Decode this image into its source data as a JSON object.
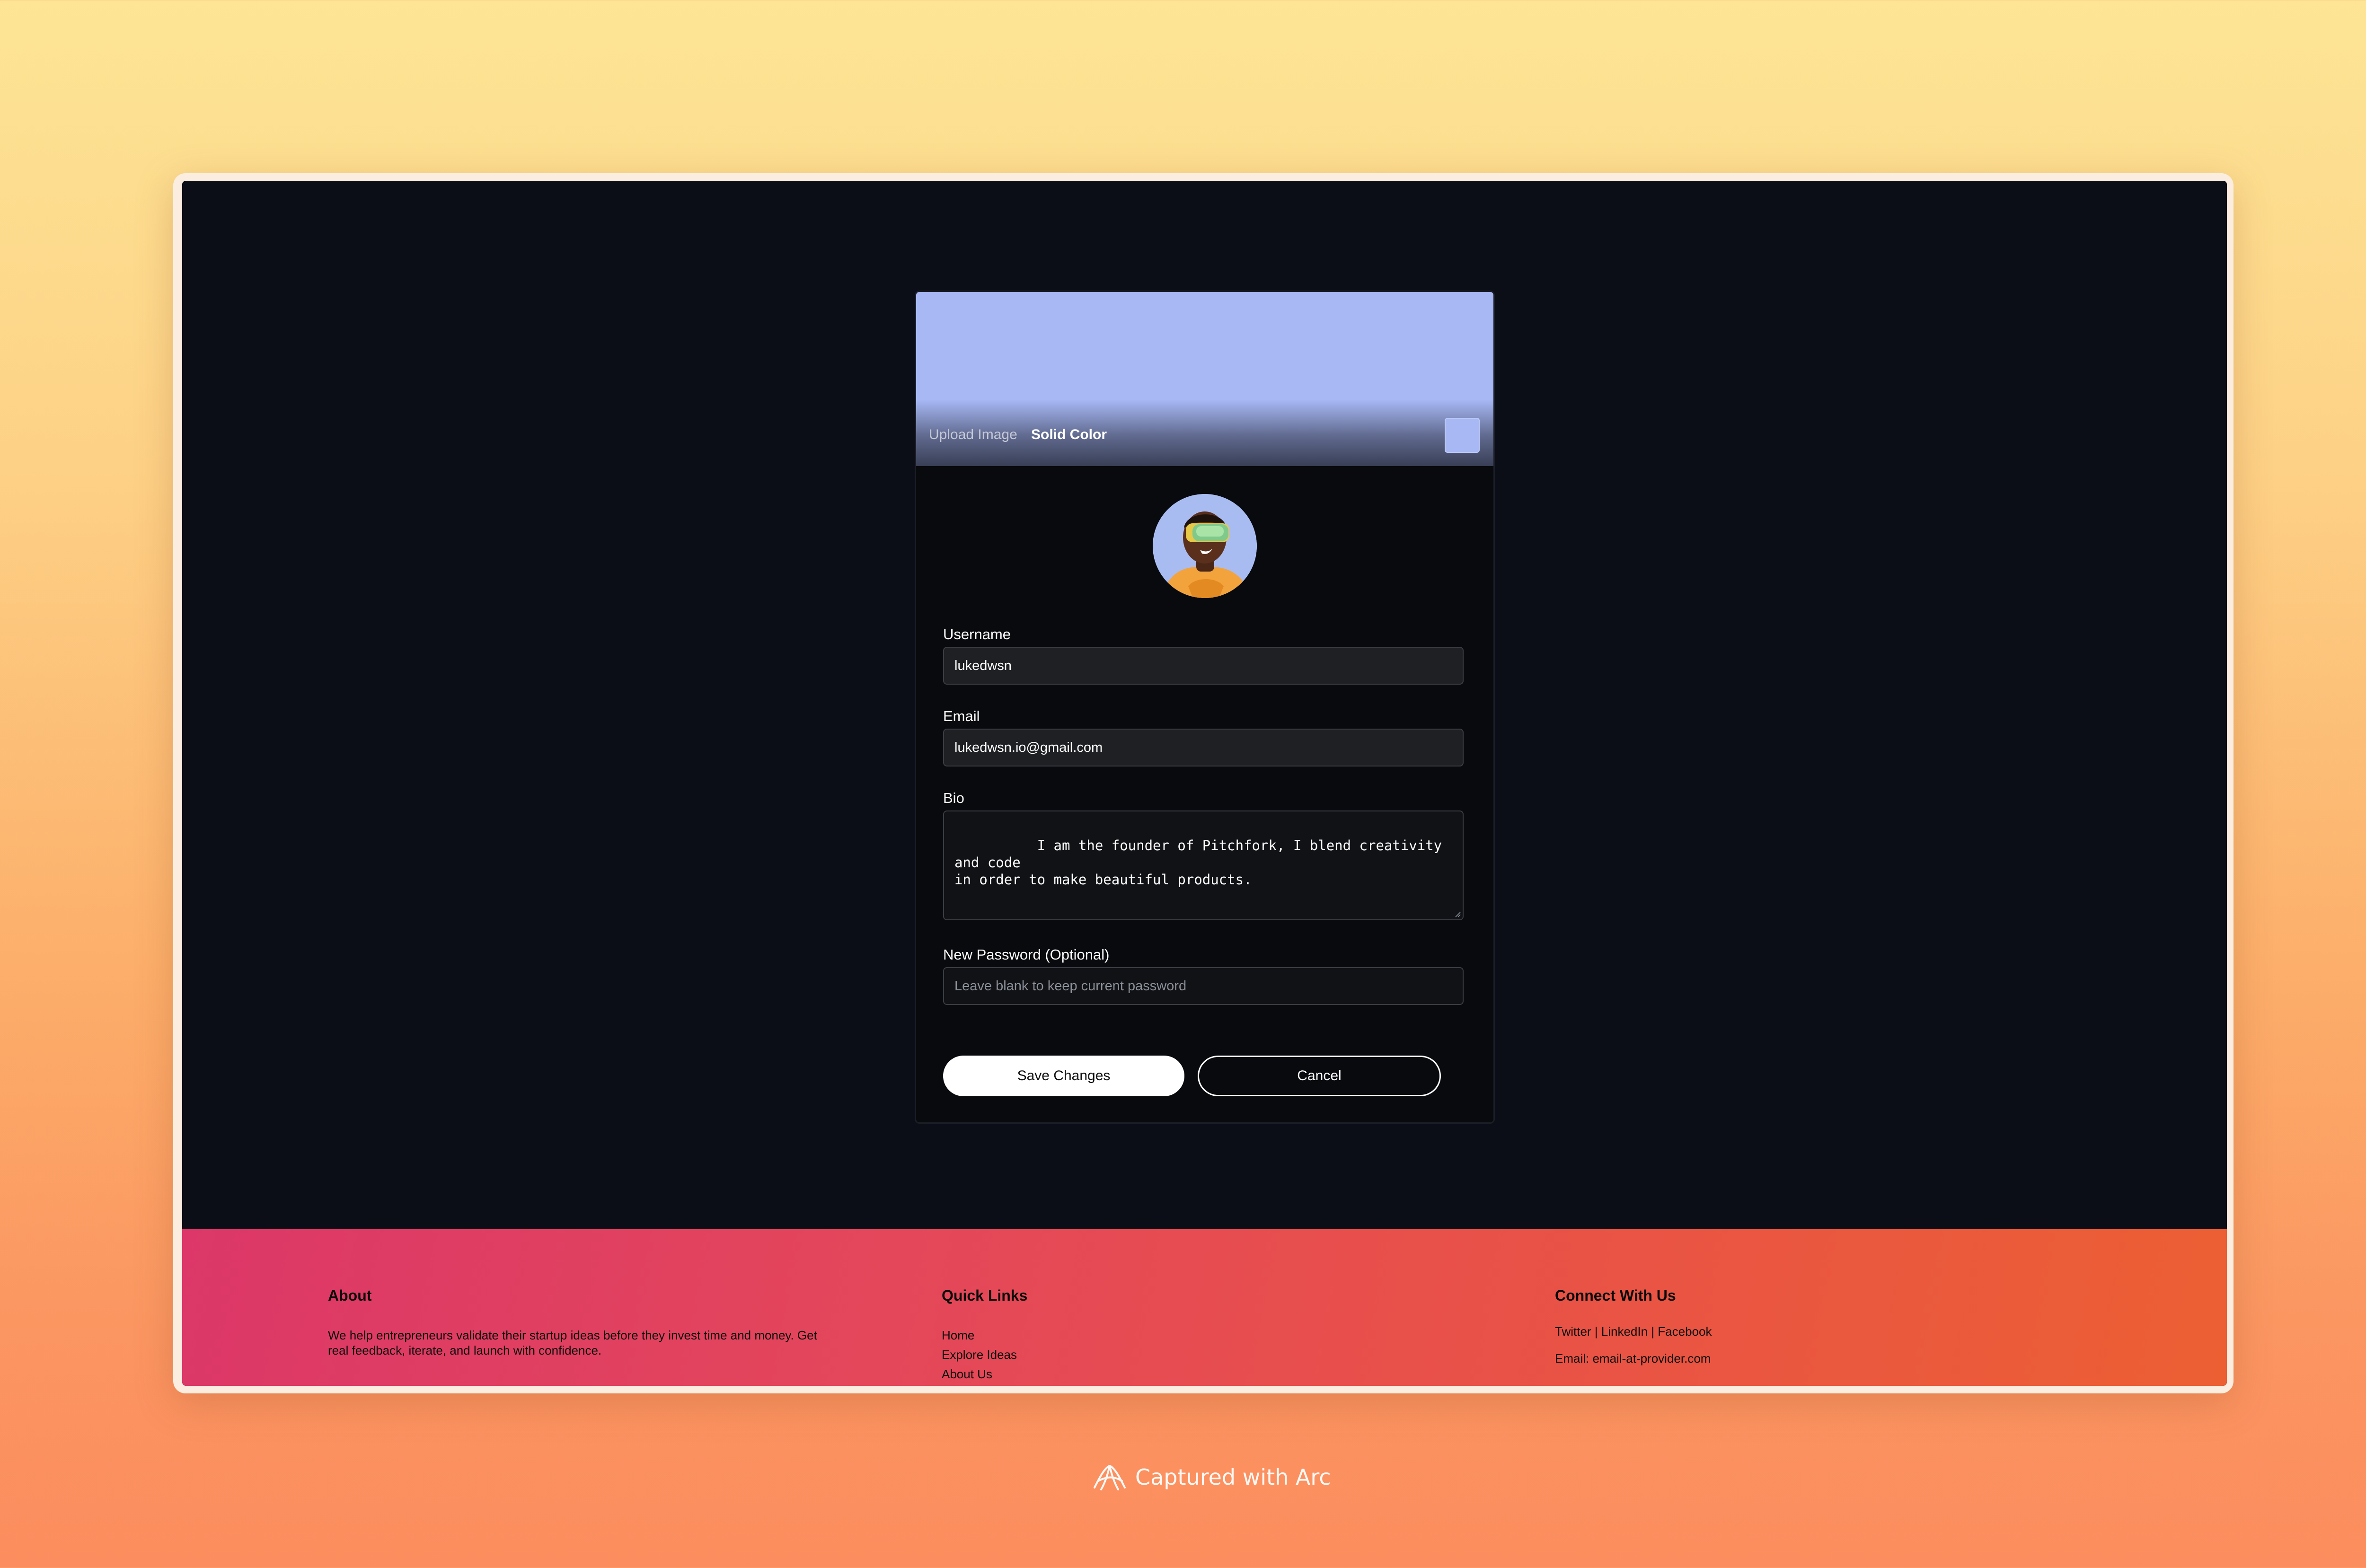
{
  "banner": {
    "tabs": [
      "Upload Image",
      "Solid Color"
    ],
    "active_tab": "Solid Color",
    "color": "#a7b8f5"
  },
  "avatar": {
    "icon": "vr-headset-avatar"
  },
  "form": {
    "username": {
      "label": "Username",
      "value": "lukedwsn"
    },
    "email": {
      "label": "Email",
      "value": "lukedwsn.io@gmail.com"
    },
    "bio": {
      "label": "Bio",
      "value": "I am the founder of Pitchfork, I blend creativity and code\nin order to make beautiful products."
    },
    "password": {
      "label": "New Password (Optional)",
      "placeholder": "Leave blank to keep current password"
    },
    "save_label": "Save Changes",
    "cancel_label": "Cancel"
  },
  "footer": {
    "about": {
      "heading": "About",
      "text_line1": "We help entrepreneurs validate their startup ideas before they invest time and money. Get",
      "text_line2": "real feedback, iterate, and launch with confidence."
    },
    "quick_links": {
      "heading": "Quick Links",
      "items": [
        "Home",
        "Explore Ideas",
        "About Us"
      ]
    },
    "connect": {
      "heading": "Connect With Us",
      "social": "Twitter | LinkedIn | Facebook",
      "email": "Email: email-at-provider.com"
    }
  },
  "watermark": {
    "text": "Captured with Arc",
    "icon": "arc-logo-icon"
  }
}
